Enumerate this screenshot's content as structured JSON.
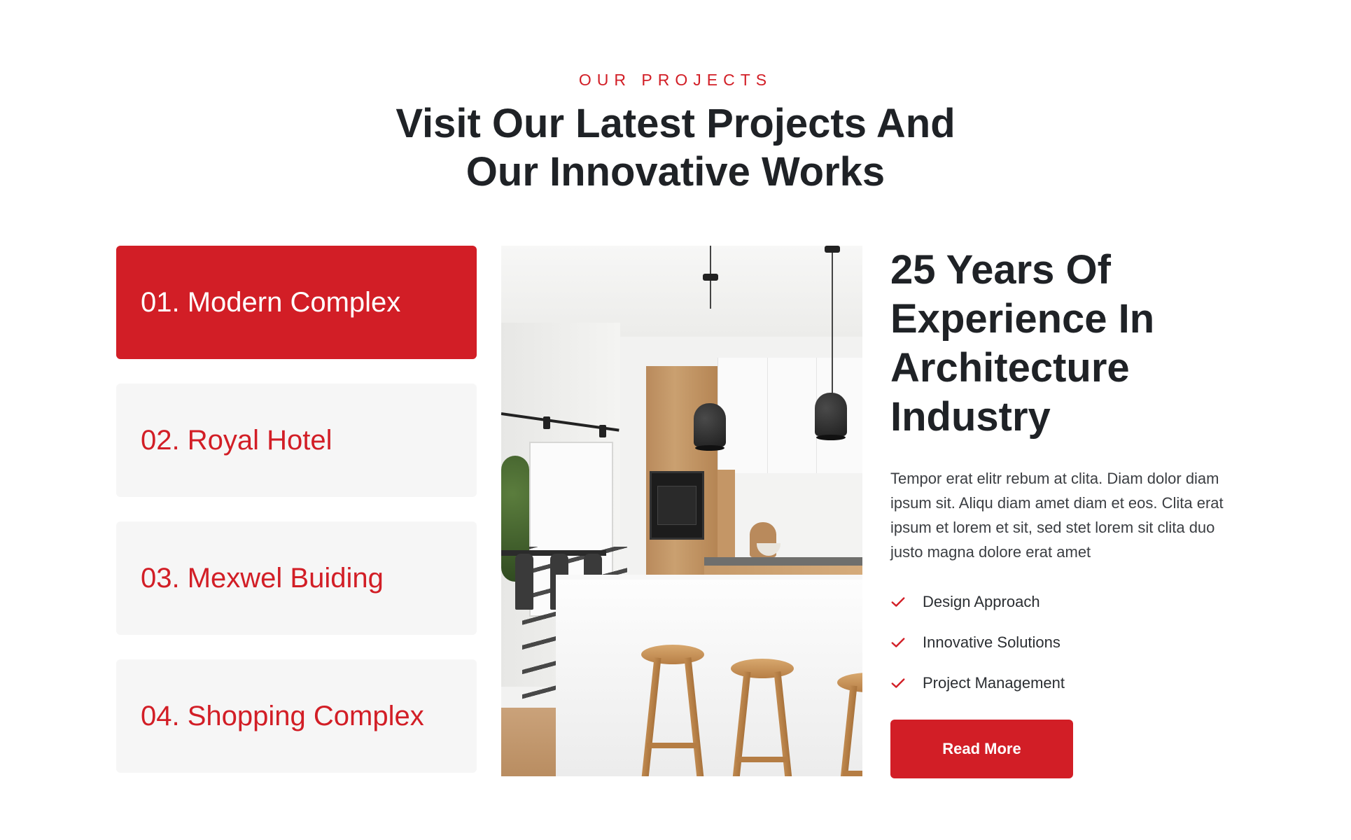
{
  "header": {
    "eyebrow": "OUR PROJECTS",
    "title_line1": "Visit Our Latest Projects And",
    "title_line2": "Our Innovative Works"
  },
  "projects": {
    "active_index": 0,
    "tabs": [
      {
        "label": "01. Modern Complex"
      },
      {
        "label": "02. Royal Hotel"
      },
      {
        "label": "03. Mexwel Buiding"
      },
      {
        "label": "04. Shopping Complex"
      }
    ]
  },
  "image": {
    "subject": "modern-kitchen-interior"
  },
  "content": {
    "title_lines": [
      "25 Years Of",
      "Experience In",
      "Architecture",
      "Industry"
    ],
    "description": "Tempor erat elitr rebum at clita. Diam dolor diam ipsum sit. Aliqu diam amet diam et eos. Clita erat ipsum et lorem et sit, sed stet lorem sit clita duo justo magna dolore erat amet",
    "features": [
      {
        "label": "Design Approach",
        "icon": "check-icon"
      },
      {
        "label": "Innovative Solutions",
        "icon": "check-icon"
      },
      {
        "label": "Project Management",
        "icon": "check-icon"
      }
    ],
    "button_label": "Read More"
  },
  "colors": {
    "accent": "#d21e26",
    "heading": "#1f2226",
    "tab_background": "#f6f6f6"
  }
}
